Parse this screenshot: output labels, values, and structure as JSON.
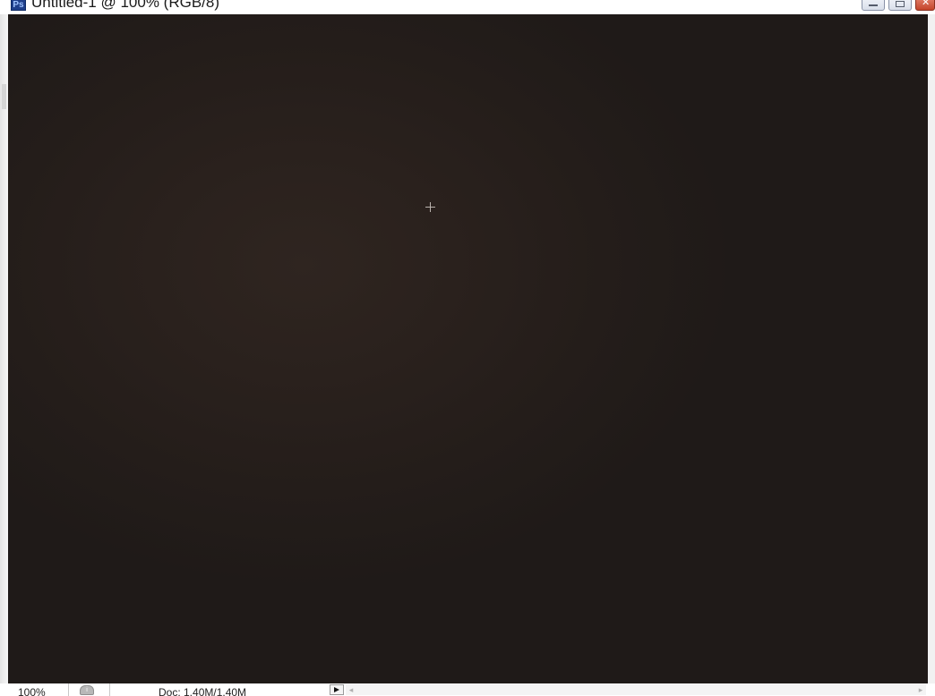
{
  "window": {
    "app_icon_label": "Ps",
    "title": "Untitled-1 @ 100% (RGB/8)"
  },
  "icons": {
    "app": "photoshop-icon",
    "minimize": "minimize-icon",
    "maximize": "maximize-icon",
    "close": "close-icon",
    "crosshair": "crosshair-cursor-icon",
    "info": "document-info-icon",
    "menu_arrow": "play-triangle-icon",
    "scroll_left": "chevron-left-icon",
    "scroll_right": "chevron-right-icon"
  },
  "canvas": {
    "background_color": "#1f1a18",
    "highlight_color": "#2f2520"
  },
  "status_bar": {
    "zoom": "100%",
    "doc_size": "Doc: 1.40M/1.40M",
    "close_glyph": "✕",
    "scroll_left_glyph": "◂",
    "scroll_right_glyph": "▸",
    "info_glyph": "i"
  }
}
